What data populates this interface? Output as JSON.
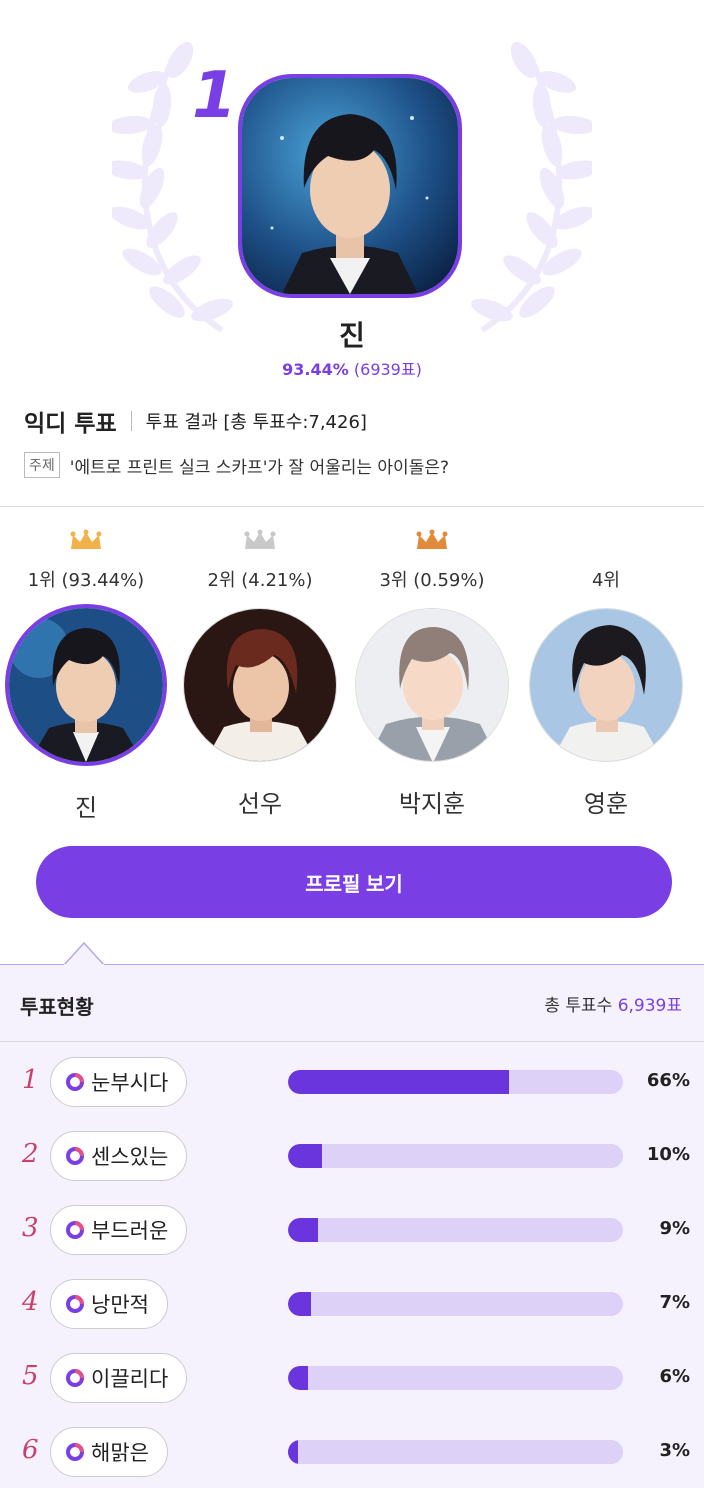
{
  "colors": {
    "accent": "#7a3fe4",
    "rank_num": "#c6426b",
    "bar_fill": "#6a35dc",
    "bar_track": "#ddd1f7",
    "gold": "#f2b24a",
    "silver": "#c8c8c8",
    "bronze": "#e08a3a"
  },
  "winner": {
    "rank": "1",
    "name": "진",
    "percent": "93.44%",
    "votes": "(6939표)"
  },
  "poll": {
    "brand": "익디 투표",
    "result_label": "투표 결과 [총 투표수:7,426]",
    "topic_tag": "주제",
    "topic": "'에트로 프린트 실크 스카프'가 잘 어울리는 아이돌은?"
  },
  "candidates": [
    {
      "rank_label": "1위 (93.44%)",
      "name": "진",
      "crown": "gold-crown-icon"
    },
    {
      "rank_label": "2위 (4.21%)",
      "name": "선우",
      "crown": "silver-crown-icon"
    },
    {
      "rank_label": "3위 (0.59%)",
      "name": "박지훈",
      "crown": "bronze-crown-icon"
    },
    {
      "rank_label": "4위",
      "name": "영훈",
      "crown": ""
    }
  ],
  "profile_button": "프로필 보기",
  "status": {
    "title": "투표현황",
    "total_label": "총 투표수",
    "total_value": "6,939표",
    "rows": [
      {
        "num": "1",
        "label": "눈부시다",
        "percent_text": "66%",
        "value": 66
      },
      {
        "num": "2",
        "label": "센스있는",
        "percent_text": "10%",
        "value": 10
      },
      {
        "num": "3",
        "label": "부드러운",
        "percent_text": "9%",
        "value": 9
      },
      {
        "num": "4",
        "label": "낭만적",
        "percent_text": "7%",
        "value": 7
      },
      {
        "num": "5",
        "label": "이끌리다",
        "percent_text": "6%",
        "value": 6
      },
      {
        "num": "6",
        "label": "해맑은",
        "percent_text": "3%",
        "value": 3
      }
    ]
  }
}
